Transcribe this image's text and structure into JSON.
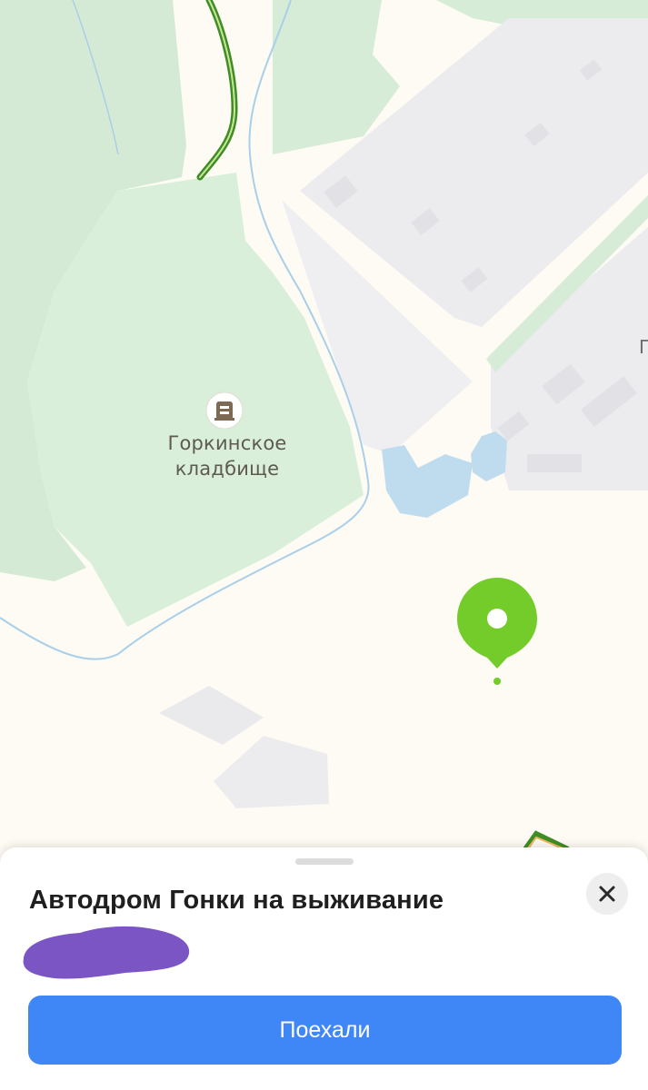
{
  "map": {
    "poi": {
      "icon": "cemetery-icon",
      "name_line1": "Горкинское",
      "name_line2": "кладбище"
    },
    "edge_label": "Г",
    "pin": {
      "icon": "location-pin-icon",
      "color": "#73cc2a"
    }
  },
  "sheet": {
    "title": "Автодром Гонки на выживание",
    "close_icon": "close-icon",
    "redaction_color": "#7b55c4",
    "go_button_label": "Поехали"
  },
  "colors": {
    "forest": "#d6ecd7",
    "open_ground": "#fdfbf3",
    "buildings": "#ededf0",
    "water": "#bcdcf0",
    "accent": "#3f86f6"
  }
}
